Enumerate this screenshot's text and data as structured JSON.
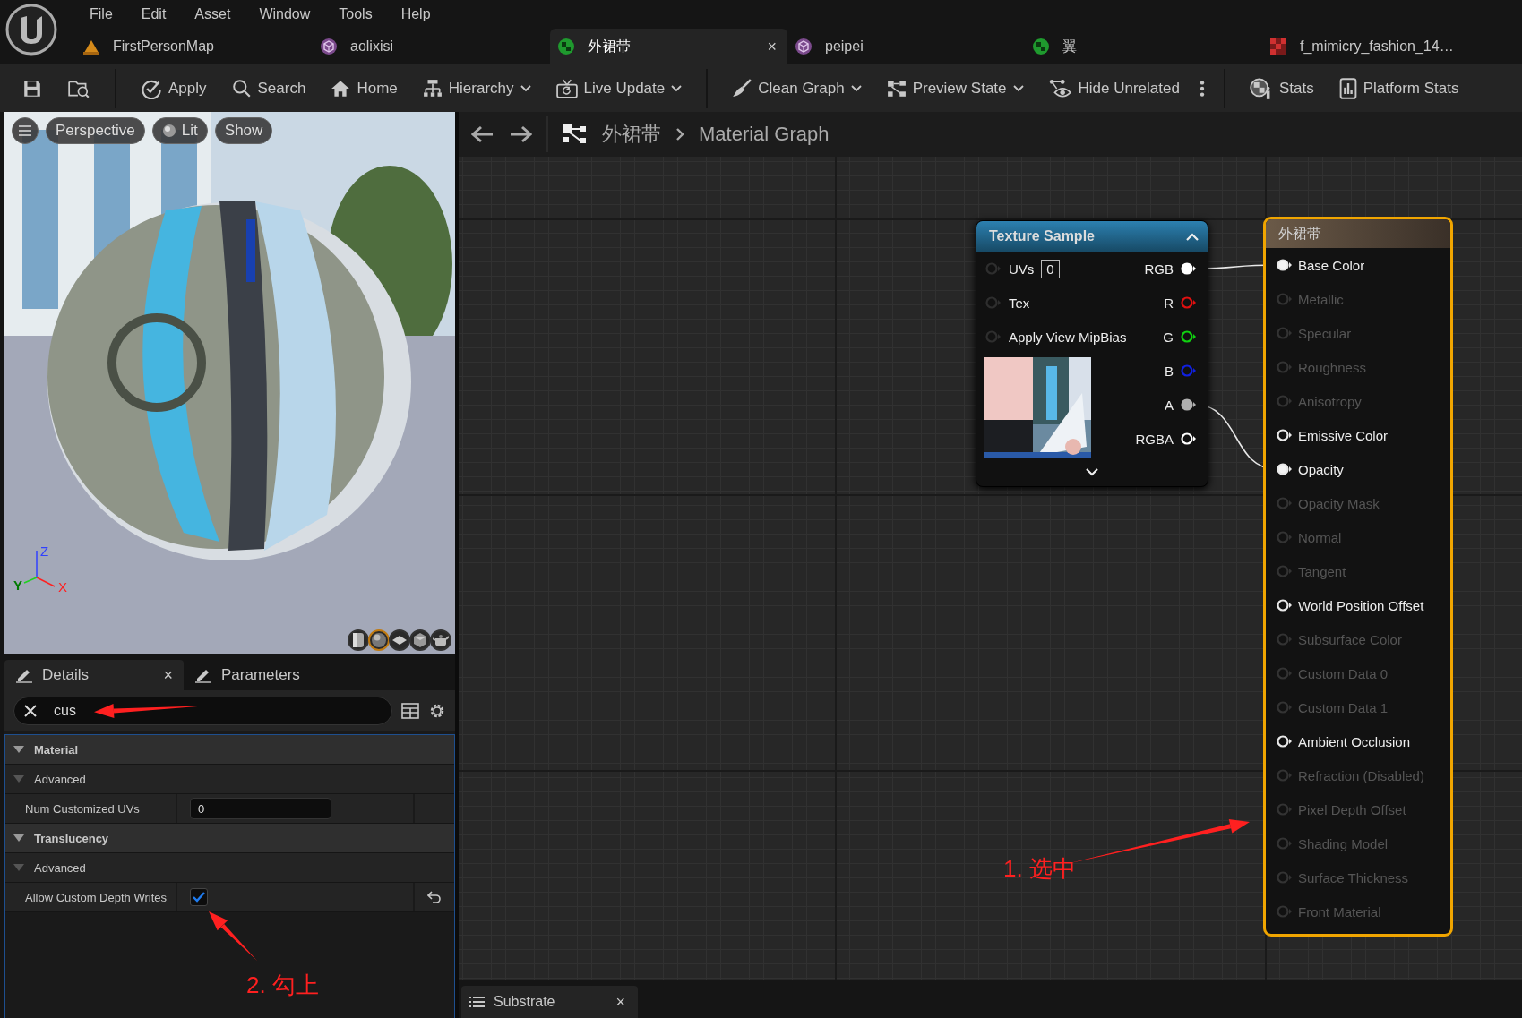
{
  "menu": [
    "File",
    "Edit",
    "Asset",
    "Window",
    "Tools",
    "Help"
  ],
  "document_tabs": [
    {
      "label": "FirstPersonMap",
      "kind": "level",
      "selected": false
    },
    {
      "label": "aolixisi",
      "kind": "mesh",
      "selected": false
    },
    {
      "label": "外裙带",
      "kind": "material",
      "selected": true,
      "close": "×"
    },
    {
      "label": "peipei",
      "kind": "mesh",
      "selected": false
    },
    {
      "label": "翼",
      "kind": "material",
      "selected": false
    },
    {
      "label": "f_mimicry_fashion_14…",
      "kind": "texture",
      "selected": false
    }
  ],
  "toolbar": [
    {
      "kind": "save"
    },
    {
      "kind": "browse"
    },
    {
      "kind": "separator"
    },
    {
      "kind": "apply",
      "label": "Apply",
      "dropdown": false
    },
    {
      "kind": "search",
      "label": "Search",
      "dropdown": false
    },
    {
      "kind": "home",
      "label": "Home",
      "dropdown": false
    },
    {
      "kind": "hierarchy",
      "label": "Hierarchy",
      "dropdown": true
    },
    {
      "kind": "live",
      "label": "Live Update",
      "dropdown": true
    },
    {
      "kind": "separator"
    },
    {
      "kind": "clean",
      "label": "Clean Graph",
      "dropdown": true
    },
    {
      "kind": "preview",
      "label": "Preview State",
      "dropdown": true
    },
    {
      "kind": "hide",
      "label": "Hide Unrelated",
      "dropdown": false
    },
    {
      "kind": "more"
    },
    {
      "kind": "separator"
    },
    {
      "kind": "stats",
      "label": "Stats",
      "dropdown": false
    },
    {
      "kind": "platform",
      "label": "Platform Stats",
      "dropdown": false
    }
  ],
  "viewport": {
    "buttons": [
      {
        "label": "Perspective",
        "kind": "plain"
      },
      {
        "label": "Lit",
        "kind": "lit"
      },
      {
        "label": "Show",
        "kind": "plain"
      }
    ],
    "axes": {
      "z": "Z",
      "x": "X",
      "y": "Y"
    },
    "preview_shapes": [
      {
        "kind": "cylinder",
        "selected": false
      },
      {
        "kind": "sphere",
        "selected": true
      },
      {
        "kind": "plane",
        "selected": false
      },
      {
        "kind": "cube",
        "selected": false
      },
      {
        "kind": "custom",
        "selected": false
      }
    ]
  },
  "details": {
    "tabs": [
      {
        "label": "Details",
        "selected": true,
        "close": "×"
      },
      {
        "label": "Parameters",
        "selected": false
      }
    ],
    "search": {
      "value": "cus"
    },
    "properties": [
      {
        "kind": "category",
        "label": "Material",
        "expanded": true
      },
      {
        "kind": "subcategory",
        "label": "Advanced",
        "expanded": true
      },
      {
        "kind": "number",
        "label": "Num Customized UVs",
        "value": "0"
      },
      {
        "kind": "category",
        "label": "Translucency",
        "expanded": true
      },
      {
        "kind": "subcategory",
        "label": "Advanced",
        "expanded": true
      },
      {
        "kind": "checkbox",
        "label": "Allow Custom Depth Writes",
        "checked": true,
        "modified": true
      }
    ],
    "annotation": "2. 勾上"
  },
  "graph": {
    "breadcrumb": [
      "外裙带",
      "Material Graph"
    ],
    "texture_node": {
      "title": "Texture Sample",
      "inputs": [
        {
          "label": "UVs",
          "value": "0"
        },
        {
          "label": "Tex"
        },
        {
          "label": "Apply View MipBias"
        }
      ],
      "outputs": [
        {
          "label": "RGB",
          "color": "#ffffff",
          "connected": true
        },
        {
          "label": "R",
          "color": "#e01010",
          "connected": false
        },
        {
          "label": "G",
          "color": "#10d010",
          "connected": false
        },
        {
          "label": "B",
          "color": "#1020e0",
          "connected": false
        },
        {
          "label": "A",
          "color": "#b0b0b0",
          "connected": true
        },
        {
          "label": "RGBA",
          "color": "#ffffff",
          "connected": false
        }
      ]
    },
    "material_node": {
      "title": "外裙带",
      "selected": true,
      "pins": [
        {
          "label": "Base Color",
          "enabled": true,
          "connected": true
        },
        {
          "label": "Metallic",
          "enabled": false,
          "connected": false
        },
        {
          "label": "Specular",
          "enabled": false,
          "connected": false
        },
        {
          "label": "Roughness",
          "enabled": false,
          "connected": false
        },
        {
          "label": "Anisotropy",
          "enabled": false,
          "connected": false
        },
        {
          "label": "Emissive Color",
          "enabled": true,
          "connected": false
        },
        {
          "label": "Opacity",
          "enabled": true,
          "connected": true
        },
        {
          "label": "Opacity Mask",
          "enabled": false,
          "connected": false
        },
        {
          "label": "Normal",
          "enabled": false,
          "connected": false
        },
        {
          "label": "Tangent",
          "enabled": false,
          "connected": false
        },
        {
          "label": "World Position Offset",
          "enabled": true,
          "connected": false
        },
        {
          "label": "Subsurface Color",
          "enabled": false,
          "connected": false
        },
        {
          "label": "Custom Data 0",
          "enabled": false,
          "connected": false
        },
        {
          "label": "Custom Data 1",
          "enabled": false,
          "connected": false
        },
        {
          "label": "Ambient Occlusion",
          "enabled": true,
          "connected": false
        },
        {
          "label": "Refraction (Disabled)",
          "enabled": false,
          "connected": false
        },
        {
          "label": "Pixel Depth Offset",
          "enabled": false,
          "connected": false
        },
        {
          "label": "Shading Model",
          "enabled": false,
          "connected": false
        },
        {
          "label": "Surface Thickness",
          "enabled": false,
          "connected": false
        },
        {
          "label": "Front Material",
          "enabled": false,
          "connected": false
        }
      ]
    },
    "annotation": "1. 选中"
  },
  "bottom_tabs": [
    {
      "label": "Substrate",
      "close": "×"
    }
  ]
}
